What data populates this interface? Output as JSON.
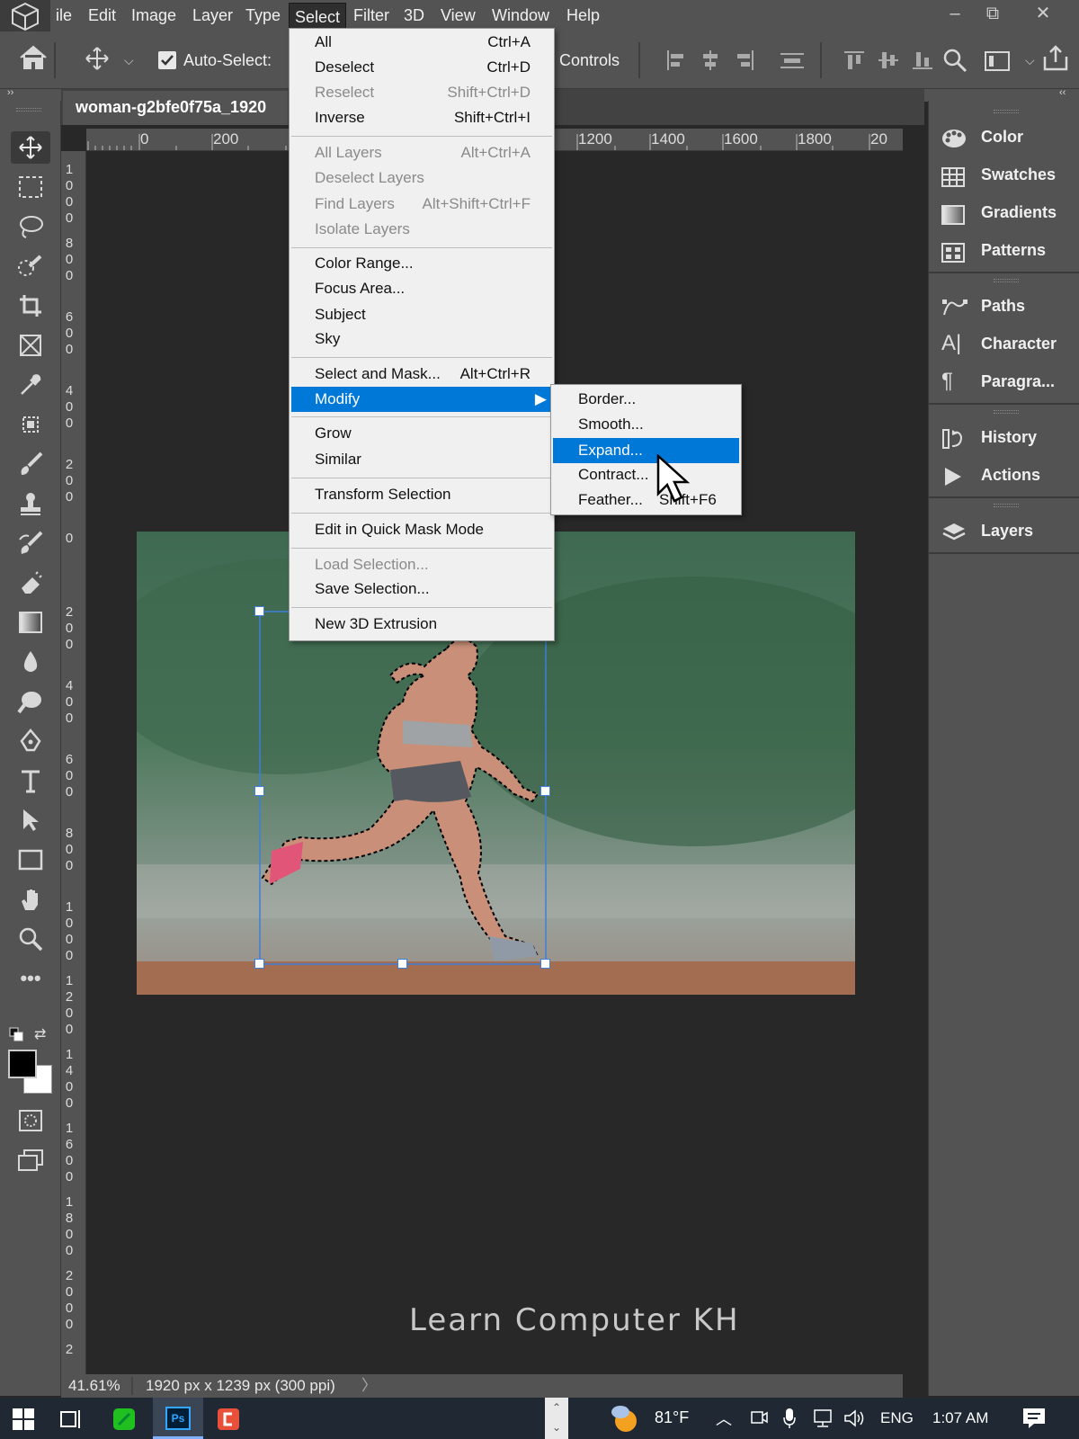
{
  "menubar": {
    "items": [
      "File",
      "Edit",
      "Image",
      "Layer",
      "Type",
      "Select",
      "Filter",
      "3D",
      "View",
      "Window",
      "Help"
    ],
    "active": "Select",
    "file_visible": "ile",
    "window_controls": {
      "minimize": "–",
      "restore": "⧉",
      "close": "✕"
    }
  },
  "options": {
    "auto_select_label": "Auto-Select:",
    "auto_select_checked": true,
    "controls_label": "Controls"
  },
  "document": {
    "tab_title": "woman-g2bfe0f75a_1920",
    "zoom": "41.61%",
    "info": "1920 px x 1239 px (300 ppi)"
  },
  "ruler": {
    "top_labels": [
      "0",
      "200",
      "1200",
      "1400",
      "1600",
      "1800",
      "20"
    ],
    "left_labels": [
      "1000",
      "800",
      "600",
      "400",
      "200",
      "0",
      "200",
      "400",
      "600",
      "800",
      "1000",
      "1200",
      "1400",
      "1600",
      "1800",
      "2000",
      "2"
    ]
  },
  "select_menu": {
    "groups": [
      [
        {
          "label": "All",
          "shortcut": "Ctrl+A",
          "disabled": false
        },
        {
          "label": "Deselect",
          "shortcut": "Ctrl+D",
          "disabled": false
        },
        {
          "label": "Reselect",
          "shortcut": "Shift+Ctrl+D",
          "disabled": true
        },
        {
          "label": "Inverse",
          "shortcut": "Shift+Ctrl+I",
          "disabled": false
        }
      ],
      [
        {
          "label": "All Layers",
          "shortcut": "Alt+Ctrl+A",
          "disabled": true
        },
        {
          "label": "Deselect Layers",
          "shortcut": "",
          "disabled": true
        },
        {
          "label": "Find Layers",
          "shortcut": "Alt+Shift+Ctrl+F",
          "disabled": true
        },
        {
          "label": "Isolate Layers",
          "shortcut": "",
          "disabled": true
        }
      ],
      [
        {
          "label": "Color Range...",
          "shortcut": "",
          "disabled": false
        },
        {
          "label": "Focus Area...",
          "shortcut": "",
          "disabled": false
        },
        {
          "label": "Subject",
          "shortcut": "",
          "disabled": false
        },
        {
          "label": "Sky",
          "shortcut": "",
          "disabled": false
        }
      ],
      [
        {
          "label": "Select and Mask...",
          "shortcut": "Alt+Ctrl+R",
          "disabled": false
        },
        {
          "label": "Modify",
          "shortcut": "",
          "disabled": false,
          "highlighted": true,
          "submenu": true
        }
      ],
      [
        {
          "label": "Grow",
          "shortcut": "",
          "disabled": false
        },
        {
          "label": "Similar",
          "shortcut": "",
          "disabled": false
        }
      ],
      [
        {
          "label": "Transform Selection",
          "shortcut": "",
          "disabled": false
        }
      ],
      [
        {
          "label": "Edit in Quick Mask Mode",
          "shortcut": "",
          "disabled": false
        }
      ],
      [
        {
          "label": "Load Selection...",
          "shortcut": "",
          "disabled": true
        },
        {
          "label": "Save Selection...",
          "shortcut": "",
          "disabled": false
        }
      ],
      [
        {
          "label": "New 3D Extrusion",
          "shortcut": "",
          "disabled": false
        }
      ]
    ]
  },
  "modify_submenu": [
    {
      "label": "Border...",
      "shortcut": ""
    },
    {
      "label": "Smooth...",
      "shortcut": ""
    },
    {
      "label": "Expand...",
      "shortcut": "",
      "highlighted": true
    },
    {
      "label": "Contract...",
      "shortcut": ""
    },
    {
      "label": "Feather...",
      "shortcut": "Shift+F6"
    }
  ],
  "panels": {
    "items": [
      {
        "label": "Color",
        "icon": "color-icon",
        "group": 1
      },
      {
        "label": "Swatches",
        "icon": "swatches-icon",
        "group": 1
      },
      {
        "label": "Gradients",
        "icon": "gradients-icon",
        "group": 1
      },
      {
        "label": "Patterns",
        "icon": "patterns-icon",
        "group": 1
      },
      {
        "label": "Paths",
        "icon": "paths-icon",
        "group": 2
      },
      {
        "label": "Character",
        "icon": "character-icon",
        "group": 2
      },
      {
        "label": "Paragra...",
        "icon": "paragraph-icon",
        "group": 2
      },
      {
        "label": "History",
        "icon": "history-icon",
        "group": 3
      },
      {
        "label": "Actions",
        "icon": "actions-icon",
        "group": 3
      },
      {
        "label": "Layers",
        "icon": "layers-icon",
        "group": 4
      }
    ]
  },
  "taskbar": {
    "weather": "81°F",
    "language": "ENG",
    "time": "1:07 AM"
  },
  "watermark": "Learn Computer KH",
  "colors": {
    "accent": "#0078d7",
    "ui_gray": "#535353",
    "canvas_bg": "#282828",
    "foreground_swatch": "#000000",
    "background_swatch": "#ffffff"
  }
}
